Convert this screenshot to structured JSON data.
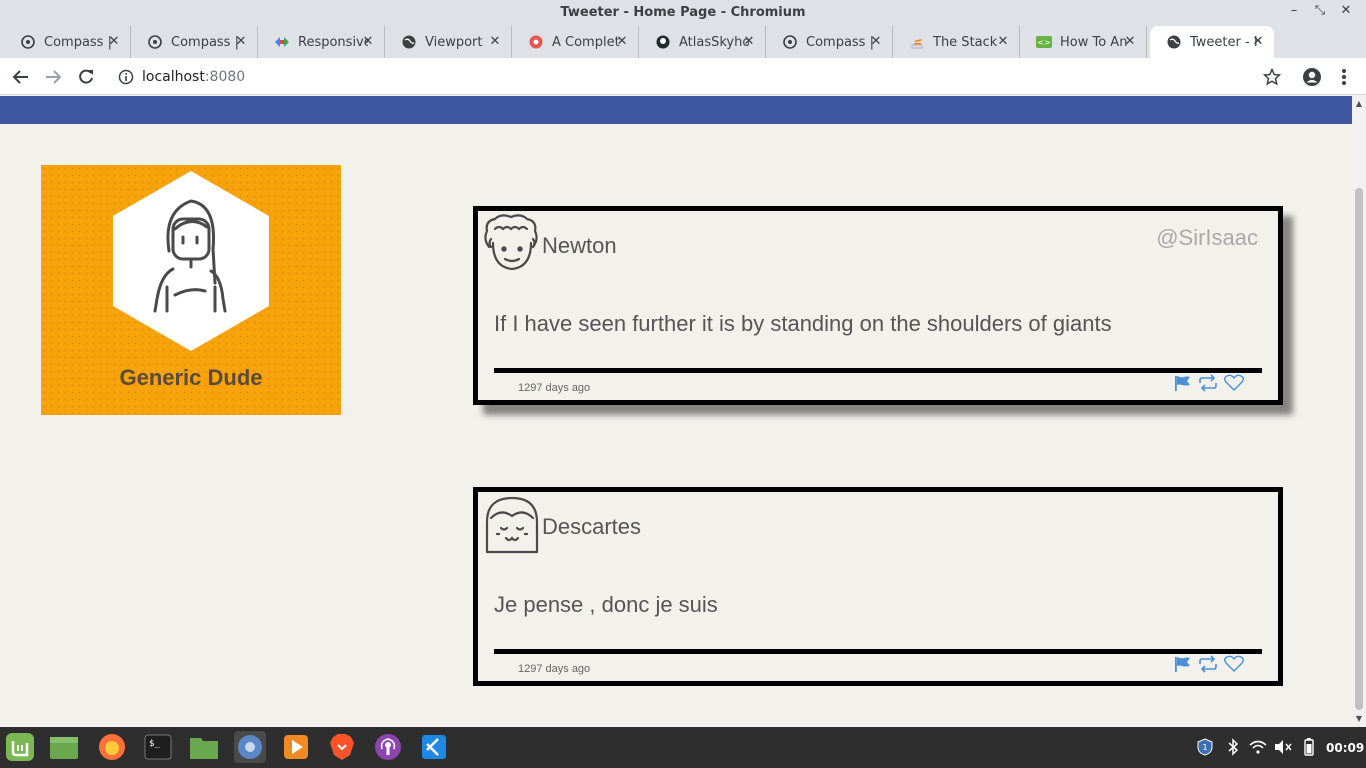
{
  "window": {
    "title": "Tweeter - Home Page - Chromium"
  },
  "tabs": [
    {
      "label": "Compass |",
      "icon": "compass-icon"
    },
    {
      "label": "Compass |",
      "icon": "compass-icon"
    },
    {
      "label": "Responsive",
      "icon": "devtools-icon"
    },
    {
      "label": "Viewport",
      "icon": "globe-icon"
    },
    {
      "label": "A Complet",
      "icon": "flower-icon"
    },
    {
      "label": "AtlasSkyho",
      "icon": "github-icon"
    },
    {
      "label": "Compass |",
      "icon": "compass-icon"
    },
    {
      "label": "The Stack",
      "icon": "stackoverflow-icon"
    },
    {
      "label": "How To An",
      "icon": "code-icon"
    },
    {
      "label": "Tweeter - H",
      "icon": "globe-icon"
    }
  ],
  "toolbar": {
    "url_host": "localhost",
    "url_port": ":8080"
  },
  "profile": {
    "name": "Generic Dude"
  },
  "tweets": [
    {
      "name": "Newton",
      "handle": "@SirIsaac",
      "text": "If I have seen further it is by standing on the shoulders of giants",
      "time": "1297 days ago"
    },
    {
      "name": "Descartes",
      "handle": "",
      "text": "Je pense , donc je suis",
      "time": "1297 days ago"
    }
  ],
  "taskbar": {
    "clock": "00:09"
  },
  "colors": {
    "header": "#3e55a2",
    "card": "#f7a30c",
    "background": "#f3f1ec",
    "action": "#4a90d9"
  }
}
